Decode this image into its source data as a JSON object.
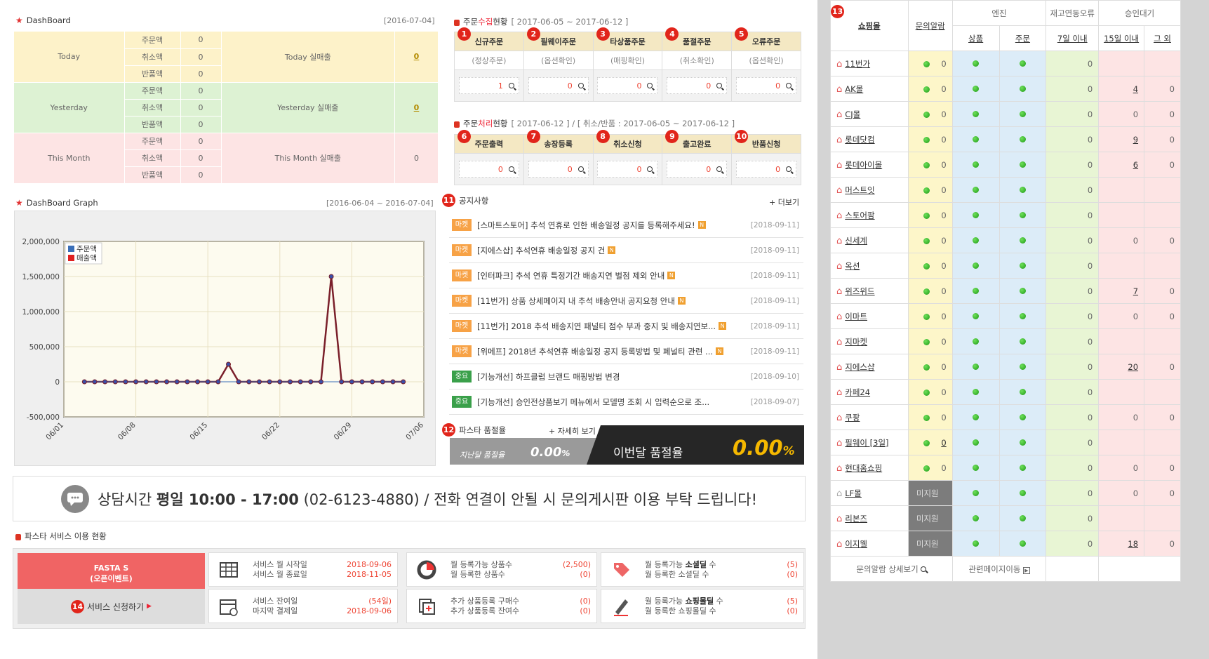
{
  "dashboard": {
    "title": "DashBoard",
    "date": "[2016-07-04]",
    "rows": [
      {
        "period": "Today",
        "labels": [
          "주문액",
          "취소액",
          "반품액"
        ],
        "values": [
          "0",
          "0",
          "0"
        ],
        "sales_label": "Today  실매출",
        "sales_value": "0"
      },
      {
        "period": "Yesterday",
        "labels": [
          "주문액",
          "취소액",
          "반품액"
        ],
        "values": [
          "0",
          "0",
          "0"
        ],
        "sales_label": "Yesterday 실매출",
        "sales_value": "0"
      },
      {
        "period": "This Month",
        "labels": [
          "주문액",
          "취소액",
          "반품액"
        ],
        "values": [
          "0",
          "0",
          "0"
        ],
        "sales_label": "This Month 실매출",
        "sales_value": "0"
      }
    ]
  },
  "graph": {
    "title": "DashBoard Graph",
    "range": "[2016-06-04 ~ 2016-07-04]"
  },
  "chart_data": {
    "type": "line",
    "x": [
      "06/03",
      "06/04",
      "06/05",
      "06/06",
      "06/07",
      "06/08",
      "06/09",
      "06/10",
      "06/11",
      "06/12",
      "06/13",
      "06/14",
      "06/15",
      "06/16",
      "06/17",
      "06/18",
      "06/19",
      "06/20",
      "06/21",
      "06/22",
      "06/23",
      "06/24",
      "06/25",
      "06/26",
      "06/27",
      "06/28",
      "06/29",
      "06/30",
      "07/01",
      "07/02",
      "07/03",
      "07/04"
    ],
    "series": [
      {
        "name": "주문액",
        "values": [
          0,
          0,
          0,
          0,
          0,
          0,
          0,
          0,
          0,
          0,
          0,
          0,
          0,
          0,
          0,
          0,
          0,
          0,
          0,
          0,
          0,
          0,
          0,
          0,
          0,
          0,
          0,
          0,
          0,
          0,
          0,
          0
        ]
      },
      {
        "name": "매출액",
        "values": [
          0,
          0,
          0,
          0,
          0,
          0,
          0,
          0,
          0,
          0,
          0,
          0,
          0,
          0,
          250000,
          0,
          0,
          0,
          0,
          0,
          0,
          0,
          0,
          0,
          1500000,
          0,
          0,
          0,
          0,
          0,
          0,
          0
        ]
      }
    ],
    "ylim": [
      -500000,
      2000000
    ],
    "yticks": [
      "2,000,000",
      "1,500,000",
      "1,000,000",
      "500,000",
      "0",
      "-500,000"
    ],
    "xticks": [
      "06/01",
      "06/08",
      "06/15",
      "06/22",
      "06/29",
      "07/06"
    ],
    "legend": "top-left",
    "colors": {
      "주문액": "#3a6fb8",
      "매출액": "#e02020"
    }
  },
  "collect": {
    "title_pre": "주문",
    "title_hl": "수집",
    "title_post": "현황",
    "range": "[ 2017-06-05 ~ 2017-06-12 ]",
    "cols": [
      {
        "n": "1",
        "label": "신규주문",
        "sub": "(정상주문)",
        "value": "1"
      },
      {
        "n": "2",
        "label": "필웨이주문",
        "sub": "(옵션확인)",
        "value": "0"
      },
      {
        "n": "3",
        "label": "타상품주문",
        "sub": "(매핑확인)",
        "value": "0"
      },
      {
        "n": "4",
        "label": "품절주문",
        "sub": "(취소확인)",
        "value": "0"
      },
      {
        "n": "5",
        "label": "오류주문",
        "sub": "(옵션확인)",
        "value": "0"
      }
    ]
  },
  "process": {
    "title_pre": "주문",
    "title_hl": "처리",
    "title_post": "현황",
    "range": "[ 2017-06-12 ] / [ 취소/반품 : 2017-06-05 ~ 2017-06-12 ]",
    "cols": [
      {
        "n": "6",
        "label": "주문출력",
        "value": "0"
      },
      {
        "n": "7",
        "label": "송장등록",
        "value": "0"
      },
      {
        "n": "8",
        "label": "취소신청",
        "value": "0"
      },
      {
        "n": "9",
        "label": "출고완료",
        "value": "0"
      },
      {
        "n": "10",
        "label": "반품신청",
        "value": "0"
      }
    ]
  },
  "notices": {
    "n": "11",
    "title": "공지사항",
    "more": "+ 더보기",
    "items": [
      {
        "tag": "마켓",
        "text": "[스마트스토어] 추석 연휴로 인한 배송일정 공지를 등록해주세요!",
        "new": "N",
        "date": "[2018-09-11]"
      },
      {
        "tag": "마켓",
        "text": "[지에스샵] 추석연휴 배송일정 공지 건",
        "new": "N",
        "date": "[2018-09-11]"
      },
      {
        "tag": "마켓",
        "text": "[인터파크] 추석 연휴 특정기간 배송지연 벌점 제외 안내",
        "new": "N",
        "date": "[2018-09-11]"
      },
      {
        "tag": "마켓",
        "text": "[11번가] 상품 상세페이지 내 추석 배송안내 공지요청 안내",
        "new": "N",
        "date": "[2018-09-11]"
      },
      {
        "tag": "마켓",
        "text": "[11번가] 2018 추석 배송지연 패널티 점수 부과 중지 및 배송지연보...",
        "new": "N",
        "date": "[2018-09-11]"
      },
      {
        "tag": "마켓",
        "text": "[위메프] 2018년 추석연휴 배송일정 공지 등록방법 및 페널티 관련 ...",
        "new": "N",
        "date": "[2018-09-11]"
      },
      {
        "tag": "중요",
        "text": "[기능개선] 하프클럽 브랜드 매핑방법 변경",
        "new": "",
        "date": "[2018-09-10]"
      },
      {
        "tag": "중요",
        "text": "[기능개선] 승인전상품보기 메뉴에서 모델명 조회 시 입력순으로 조...",
        "new": "",
        "date": "[2018-09-07]"
      }
    ]
  },
  "soldout": {
    "n": "12",
    "title": "파스타 품절율",
    "detail": "+ 자세히 보기",
    "last_label": "지난달 품절율",
    "last_value": "0.00",
    "this_label": "이번달 품절율",
    "this_value": "0.00",
    "unit": "%"
  },
  "banner": {
    "pre": "상담시간 ",
    "bold": "평일 10:00 - 17:00",
    "post": " (02-6123-4880) / 전화 연결이 안될 시 문의게시판 이용 부탁 드립니다!"
  },
  "service": {
    "title": "파스타 서비스 이용 현황",
    "plan": "FASTA S",
    "plan_sub": "(오픈이벤트)",
    "n": "14",
    "apply": "서비스 신청하기",
    "cells": [
      {
        "l1": "서비스 월 시작일",
        "v1": "2018-09-06",
        "l2": "서비스 월 종료일",
        "v2": "2018-11-05"
      },
      {
        "l1": "월 등록가능 상품수",
        "v1": "(2,500)",
        "l2": "월 등록한 상품수",
        "v2": "(0)"
      },
      {
        "l1": "월 등록가능 ",
        "b1": "소셜딜",
        "l1b": " 수",
        "v1": "(5)",
        "l2": "월 등록한 소셜딜 수",
        "v2": "(0)"
      },
      {
        "l1": "서비스 잔여일",
        "v1": "(54일)",
        "l2": "마지막 결제일",
        "v2": "2018-09-06"
      },
      {
        "l1": "추가 상품등록 구매수",
        "v1": "(0)",
        "l2": "추가 상품등록 잔여수",
        "v2": "(0)"
      },
      {
        "l1": "월 등록가능 ",
        "b1": "쇼핑몰딜",
        "l1b": " 수",
        "v1": "(5)",
        "l2": "월 등록한 쇼핑몰딜 수",
        "v2": "(0)"
      }
    ]
  },
  "shops": {
    "n": "13",
    "headers": {
      "mall": "쇼핑몰",
      "inquiry": "문의알람",
      "engine": "엔진",
      "stock": "재고연동오류",
      "approval": "승인대기",
      "product": "상품",
      "order": "주문",
      "days7": "7일 이내",
      "days15": "15일 이내",
      "other": "그 외"
    },
    "rows": [
      {
        "name": "11번가",
        "inq": "0",
        "stock": "0",
        "d15": "",
        "other": ""
      },
      {
        "name": "AK몰",
        "inq": "0",
        "stock": "0",
        "d15": "4",
        "other": "0"
      },
      {
        "name": "CJ몰",
        "inq": "0",
        "stock": "0",
        "d15": "0",
        "other": "0"
      },
      {
        "name": "롯데닷컴",
        "inq": "0",
        "stock": "0",
        "d15": "9",
        "other": "0"
      },
      {
        "name": "롯데아이몰",
        "inq": "0",
        "stock": "0",
        "d15": "6",
        "other": "0"
      },
      {
        "name": "머스트잇",
        "inq": "0",
        "stock": "0",
        "d15": "",
        "other": ""
      },
      {
        "name": "스토어팜",
        "inq": "0",
        "stock": "0",
        "d15": "",
        "other": ""
      },
      {
        "name": "신세계",
        "inq": "0",
        "stock": "0",
        "d15": "0",
        "other": "0"
      },
      {
        "name": "옥션",
        "inq": "0",
        "stock": "0",
        "d15": "",
        "other": ""
      },
      {
        "name": "위즈위드",
        "inq": "0",
        "stock": "0",
        "d15": "7",
        "other": "0"
      },
      {
        "name": "이마트",
        "inq": "0",
        "stock": "0",
        "d15": "0",
        "other": "0"
      },
      {
        "name": "지마켓",
        "inq": "0",
        "stock": "0",
        "d15": "",
        "other": ""
      },
      {
        "name": "지에스샵",
        "inq": "0",
        "stock": "0",
        "d15": "20",
        "other": "0"
      },
      {
        "name": "카페24",
        "inq": "0",
        "stock": "0",
        "d15": "",
        "other": ""
      },
      {
        "name": "쿠팡",
        "inq": "0",
        "stock": "0",
        "d15": "0",
        "other": "0"
      },
      {
        "name": "필웨이 [3일]",
        "inq": "0",
        "stock": "0",
        "d15": "",
        "other": ""
      },
      {
        "name": "현대홈쇼핑",
        "inq": "0",
        "stock": "0",
        "d15": "0",
        "other": "0"
      },
      {
        "name": "LF몰",
        "inq": "미지원",
        "stock": "0",
        "d15": "0",
        "other": "0"
      },
      {
        "name": "리본즈",
        "inq": "미지원",
        "stock": "0",
        "d15": "",
        "other": ""
      },
      {
        "name": "이지웰",
        "inq": "미지원",
        "stock": "0",
        "d15": "18",
        "other": "0"
      }
    ],
    "footer_detail": "문의알람 상세보기",
    "footer_link": "관련페이지이동"
  }
}
